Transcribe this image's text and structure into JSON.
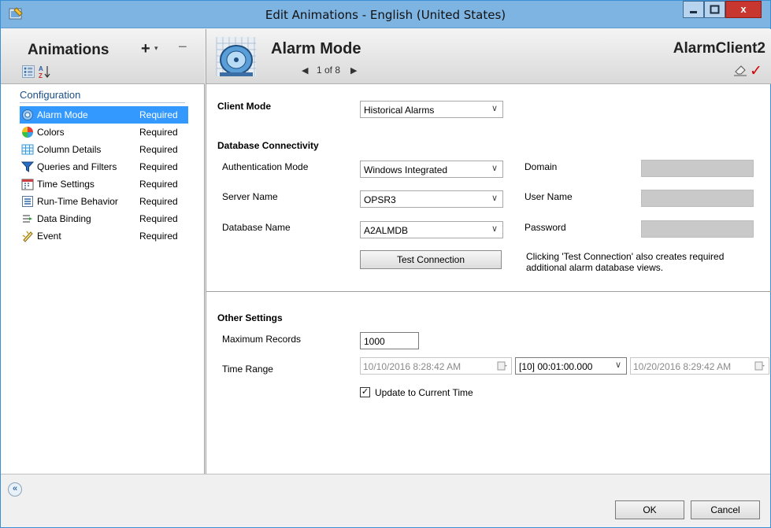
{
  "window": {
    "title": "Edit Animations - English (United States)",
    "close_label": "x"
  },
  "left": {
    "title": "Animations",
    "add_symbol": "+",
    "add_caret": "▾",
    "remove_symbol": "−",
    "az_label": "A\nZ↓",
    "category": "Configuration",
    "items": [
      {
        "label": "Alarm Mode",
        "status": "Required",
        "icon": "alarm-mode-icon",
        "color": "#4a8fd6"
      },
      {
        "label": "Colors",
        "status": "Required",
        "icon": "colors-icon",
        "color": "#e8a020"
      },
      {
        "label": "Column Details",
        "status": "Required",
        "icon": "column-details-icon",
        "color": "#3b9ad9"
      },
      {
        "label": "Queries and Filters",
        "status": "Required",
        "icon": "queries-filters-icon",
        "color": "#2b6fc4"
      },
      {
        "label": "Time Settings",
        "status": "Required",
        "icon": "time-settings-icon",
        "color": "#c94040"
      },
      {
        "label": "Run-Time Behavior",
        "status": "Required",
        "icon": "runtime-behavior-icon",
        "color": "#557799"
      },
      {
        "label": "Data Binding",
        "status": "Required",
        "icon": "data-binding-icon",
        "color": "#2e9e3e"
      },
      {
        "label": "Event",
        "status": "Required",
        "icon": "event-icon",
        "color": "#c9a02e"
      }
    ]
  },
  "header": {
    "title": "Alarm Mode",
    "prev": "◀",
    "page": "1 of 8",
    "next": "▶",
    "client": "AlarmClient2",
    "check": "✓"
  },
  "form": {
    "client_mode_label": "Client Mode",
    "client_mode_value": "Historical Alarms",
    "db_section": "Database Connectivity",
    "auth_label": "Authentication Mode",
    "auth_value": "Windows Integrated",
    "server_label": "Server Name",
    "server_value": "OPSR3",
    "database_label": "Database Name",
    "database_value": "A2ALMDB",
    "domain_label": "Domain",
    "username_label": "User Name",
    "password_label": "Password",
    "test_button": "Test Connection",
    "test_note_1": "Clicking 'Test Connection' also creates required",
    "test_note_2": "additional alarm database views.",
    "other_section": "Other Settings",
    "max_records_label": "Maximum Records",
    "max_records_value": "1000",
    "time_range_label": "Time Range",
    "start_time": "10/10/2016  8:28:42 AM",
    "duration": "[10] 00:01:00.000",
    "end_time": "10/20/2016  8:29:42 AM",
    "update_label": "Update to Current Time",
    "update_checked": true,
    "dropdown_arrow": "∨",
    "check_mark": "✓"
  },
  "footer": {
    "collapse": "«",
    "ok": "OK",
    "cancel": "Cancel"
  }
}
